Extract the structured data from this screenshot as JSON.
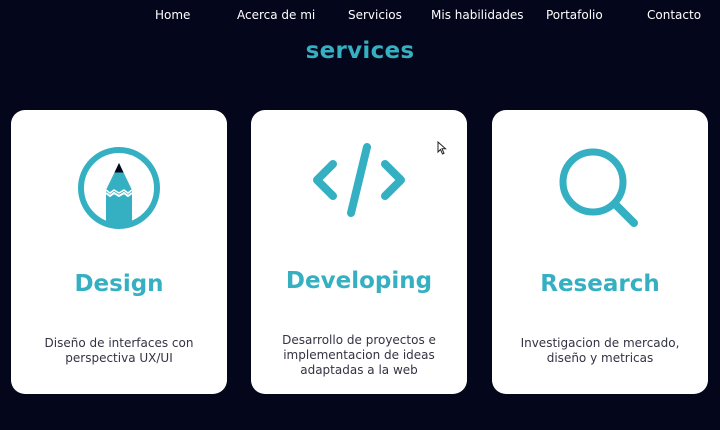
{
  "nav": {
    "items": [
      {
        "label": "Home"
      },
      {
        "label": "Acerca de mi"
      },
      {
        "label": "Servicios"
      },
      {
        "label": "Mis habilidades"
      },
      {
        "label": "Portafolio"
      },
      {
        "label": "Contacto"
      }
    ]
  },
  "section": {
    "title": "services"
  },
  "cards": [
    {
      "title": "Design",
      "description": "Diseño de interfaces con perspectiva UX/UI",
      "icon": "pencil-circle-icon"
    },
    {
      "title": "Developing",
      "description": "Desarrollo de proyectos e implementacion de ideas adaptadas a la web",
      "icon": "code-icon"
    },
    {
      "title": "Research",
      "description": "Investigacion de mercado, diseño y metricas",
      "icon": "magnifier-icon"
    }
  ],
  "colors": {
    "background": "#04071c",
    "accent": "#35b0c2",
    "card": "#ffffff",
    "text": "#333344"
  }
}
